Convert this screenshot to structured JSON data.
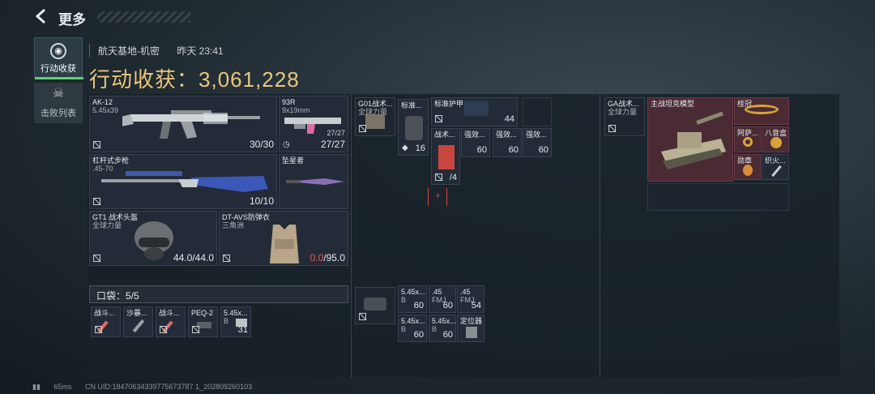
{
  "topbar": {
    "title": "更多"
  },
  "sidebar": {
    "tab1_label": "行动收获",
    "tab2_label": "击败列表"
  },
  "header": {
    "location": "航天基地-机密",
    "time": "昨天 23:41",
    "harvest_label": "行动收获：",
    "harvest_value": "3,061,228"
  },
  "loadout": {
    "primary": {
      "name": "AK-12",
      "ammo": "5.45x39",
      "count": "30/30"
    },
    "secondary": {
      "name": "93R",
      "ammo": "9x19mm",
      "count_small": "27/27",
      "count": "27/27"
    },
    "rifle": {
      "name": "杠杆式步枪",
      "ammo": ".45-70",
      "count": "10/10"
    },
    "melee": {
      "name": "坠星者"
    },
    "helmet": {
      "name": "GT1 战术头盔",
      "faction": "全球力量",
      "durability": "44.0/44.0"
    },
    "armor": {
      "name": "DT-AVS防弹衣",
      "faction": "三角洲",
      "durability_current": "0.0",
      "durability_max": "/95.0"
    }
  },
  "pouch": {
    "label": "口袋：",
    "value": "5/5",
    "items": [
      {
        "name": "战斗..."
      },
      {
        "name": "沙暴..."
      },
      {
        "name": "战斗..."
      },
      {
        "name": "PEQ-2"
      },
      {
        "name": "5.45x...",
        "sub": "B",
        "count": "31"
      }
    ]
  },
  "rig": {
    "g01": {
      "name": "G01战术...",
      "sub": "全球力量"
    },
    "stdbag": {
      "name": "标准...",
      "count": "16"
    },
    "armor2": {
      "name": "标准护甲",
      "count": "44"
    },
    "kit": {
      "name": "战术...",
      "count": "/4"
    },
    "stim1": {
      "name": "强效...",
      "count": "60"
    },
    "stim2": {
      "name": "强效...",
      "count": "60"
    },
    "stim3": {
      "name": "强效...",
      "count": "60"
    }
  },
  "backpack": {
    "items": [
      {
        "name": "5.45x...",
        "sub": "B",
        "count": "60"
      },
      {
        "name": ".45",
        "sub": "FMJ",
        "count": "60"
      },
      {
        "name": ".45",
        "sub": "FMJ",
        "count": "54"
      },
      {
        "name": "5.45x...",
        "sub": "B",
        "count": "60"
      },
      {
        "name": "5.45x...",
        "sub": "B",
        "count": "60"
      },
      {
        "name": "定位器"
      }
    ]
  },
  "loot": {
    "ga": {
      "name": "GA战术...",
      "sub": "全球力量"
    },
    "tank": {
      "name": "主战坦克模型"
    },
    "crown": {
      "name": "桂冠"
    },
    "ring1": {
      "name": "阿萨..."
    },
    "ring2": {
      "name": "八音盒"
    },
    "medal": {
      "name": "勋章"
    },
    "torch": {
      "name": "织火..."
    }
  },
  "footer": {
    "ping": "65ms",
    "uid": "CN UID:18470634339775673787 1_202809260103"
  },
  "colors": {
    "gold": "#e9c77a",
    "accent_green": "#5fd07a",
    "cell_bg": "#242b38",
    "red_cell": "#4a2b34",
    "alert_red": "#e25a5a"
  }
}
